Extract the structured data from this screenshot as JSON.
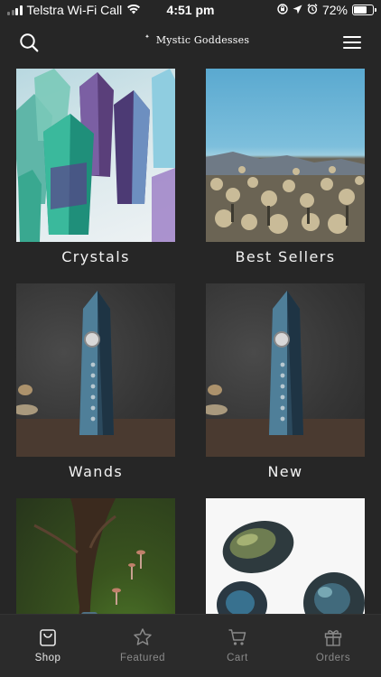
{
  "status_bar": {
    "carrier": "Telstra Wi-Fi Call",
    "time": "4:51 pm",
    "battery": "72%",
    "battery_level": 0.72
  },
  "header": {
    "brand": "Mystic Goddesses",
    "icons": [
      "search-icon",
      "crescent-moon-logo",
      "hamburger-menu-icon"
    ]
  },
  "categories": [
    {
      "label": "Crystals",
      "image": "fluorite-crystal-points"
    },
    {
      "label": "Best Sellers",
      "image": "cactus-desert-landscape"
    },
    {
      "label": "Wands",
      "image": "labradorite-wand"
    },
    {
      "label": "New",
      "image": "labradorite-wand"
    },
    {
      "label": "",
      "image": "moss-mushrooms"
    },
    {
      "label": "",
      "image": "labradorite-tumbled-stones"
    }
  ],
  "tabs": [
    {
      "label": "Shop",
      "icon": "shopping-bag-icon",
      "active": true
    },
    {
      "label": "Featured",
      "icon": "star-icon",
      "active": false
    },
    {
      "label": "Cart",
      "icon": "cart-icon",
      "active": false
    },
    {
      "label": "Orders",
      "icon": "gift-icon",
      "active": false
    }
  ],
  "colors": {
    "background": "#262626",
    "tab_active": "#e8e8e8",
    "tab_inactive": "#8a8a8a"
  }
}
